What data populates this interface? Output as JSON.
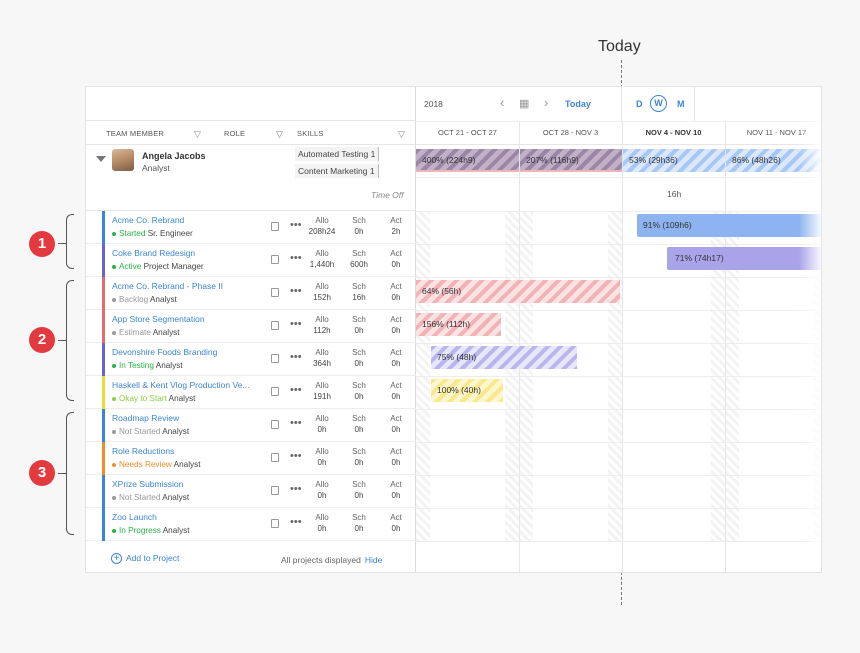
{
  "today_label": "Today",
  "colors": {
    "accent": "#3c85d4",
    "callout": "#e23a3f"
  },
  "callouts": [
    "1",
    "2",
    "3"
  ],
  "header": {
    "col_team_member": "TEAM MEMBER",
    "col_role": "ROLE",
    "col_skills": "SKILLS",
    "year": "2018",
    "today_button": "Today",
    "view_d": "D",
    "view_w": "W",
    "view_m": "M",
    "weeks": [
      "OCT 21 - OCT 27",
      "OCT 28 - NOV 3",
      "NOV 4 - NOV 10",
      "NOV 11 - NOV 17"
    ]
  },
  "person": {
    "name": "Angela Jacobs",
    "role": "Analyst",
    "skills": [
      {
        "name": "Automated Testing",
        "level": "1"
      },
      {
        "name": "Content Marketing",
        "level": "1"
      }
    ],
    "time_off_label": "Time Off",
    "time_off_value": "16h",
    "summary_bars": [
      "400% (224h9)",
      "207% (116h9)",
      "53% (29h36)",
      "86% (48h26)"
    ]
  },
  "column_labels": {
    "allo": "Allo",
    "sch": "Sch",
    "act": "Act"
  },
  "projects": [
    {
      "name": "Acme Co. Rebrand",
      "status": "Started",
      "status_color": "#2bb34a",
      "role": "Sr. Engineer",
      "allo": "208h24",
      "sch": "0h",
      "act": "2h",
      "color": "#3c85d4",
      "bar_label": "91% (109h6)"
    },
    {
      "name": "Coke Brand Redesign",
      "status": "Active",
      "status_color": "#2bb34a",
      "role": "Project Manager",
      "allo": "1,440h",
      "sch": "600h",
      "act": "0h",
      "color": "#6b63c9",
      "bar_label": "71% (74h17)"
    },
    {
      "name": "Acme Co. Rebrand - Phase II",
      "status": "Backlog",
      "status_color": "#999999",
      "role": "Analyst",
      "allo": "152h",
      "sch": "16h",
      "act": "0h",
      "color": "#e56b72",
      "bar_label": "64% (56h)"
    },
    {
      "name": "App Store Segmentation",
      "status": "Estimate",
      "status_color": "#999999",
      "role": "Analyst",
      "allo": "112h",
      "sch": "0h",
      "act": "0h",
      "color": "#e56b72",
      "bar_label": "156% (112h)"
    },
    {
      "name": "Devonshire Foods Branding",
      "status": "In Testing",
      "status_color": "#2bb34a",
      "role": "Analyst",
      "allo": "364h",
      "sch": "0h",
      "act": "0h",
      "color": "#6b63c9",
      "bar_label": "75% (48h)"
    },
    {
      "name": "Haskell & Kent Vlog Production Ve...",
      "status": "Okay to Start",
      "status_color": "#8ccf3f",
      "role": "Analyst",
      "allo": "191h",
      "sch": "0h",
      "act": "0h",
      "color": "#f2d92e",
      "bar_label": "100% (40h)"
    },
    {
      "name": "Roadmap Review",
      "status": "Not Started",
      "status_color": "#999999",
      "role": "Analyst",
      "allo": "0h",
      "sch": "0h",
      "act": "0h",
      "color": "#3c85d4",
      "bar_label": ""
    },
    {
      "name": "Role Reductions",
      "status": "Needs Review",
      "status_color": "#f08c2e",
      "role": "Analyst",
      "allo": "0h",
      "sch": "0h",
      "act": "0h",
      "color": "#f08c2e",
      "bar_label": ""
    },
    {
      "name": "XPrize Submission",
      "status": "Not Started",
      "status_color": "#999999",
      "role": "Analyst",
      "allo": "0h",
      "sch": "0h",
      "act": "0h",
      "color": "#3c85d4",
      "bar_label": ""
    },
    {
      "name": "Zoo Launch",
      "status": "In Progress",
      "status_color": "#2bb34a",
      "role": "Analyst",
      "allo": "0h",
      "sch": "0h",
      "act": "0h",
      "color": "#3c85d4",
      "bar_label": ""
    }
  ],
  "footer": {
    "add_to_project": "Add to Project",
    "all_projects": "All projects displayed",
    "hide": "Hide"
  }
}
